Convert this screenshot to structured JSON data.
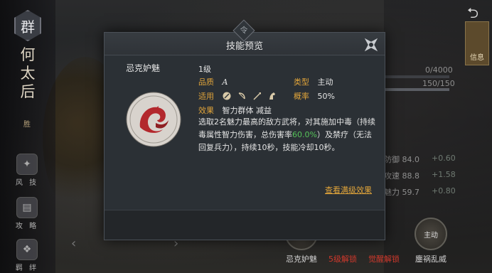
{
  "modal": {
    "title": "技能预览",
    "skill_name": "忌克妒魅",
    "level": "1级",
    "quality_label": "品质",
    "quality_value": "A",
    "type_label": "类型",
    "type_value": "主动",
    "suitable_label": "适用",
    "suitable_icons": [
      "shield-icon",
      "bow-icon",
      "spear-icon",
      "horse-icon"
    ],
    "rate_label": "概率",
    "rate_value": "50%",
    "effect_label": "效果",
    "effect_value": "智力群体 减益",
    "description_part1": "选取2名魅力最高的敌方武将，对其施加中毒（持续毒属性智力伤害，总伤害率",
    "description_highlight": "60.0%",
    "description_part2": "）及禁疗（无法回复兵力），持续10秒，技能冷却10秒。",
    "full_level_link": "查看满级效果",
    "crest_char": "令"
  },
  "hero": {
    "faction": "群",
    "name_chars": [
      "何",
      "太",
      "后"
    ],
    "sub_label": "胜"
  },
  "left_menu": [
    {
      "label": "风 技",
      "icon": "wind-icon"
    },
    {
      "label": "攻 略",
      "icon": "scroll-icon"
    },
    {
      "label": "羁 绊",
      "icon": "bond-icon"
    }
  ],
  "stats": {
    "bar1_text": "0/4000",
    "bar2_text": "150/150",
    "rows": [
      {
        "label": "防御",
        "value": "84.0",
        "plus": "+0.60"
      },
      {
        "label": "攻速",
        "value": "88.8",
        "plus": "+1.58"
      },
      {
        "label": "魅力",
        "value": "59.7",
        "plus": "+0.80"
      }
    ]
  },
  "info_tab": {
    "label": "信息"
  },
  "bottom_skills": [
    {
      "label": "忌克妒魅",
      "color": "#cfcfcf"
    },
    {
      "label": "5级解锁",
      "color": "#d0392c"
    },
    {
      "label": "觉醒解锁",
      "color": "#d0392c"
    },
    {
      "label": "鏖祸乱威",
      "color": "#cfcfcf",
      "badge": "主动"
    }
  ],
  "colors": {
    "accent_gold": "#e0a43a",
    "highlight_green": "#56c25a",
    "locked_red": "#d0392c"
  }
}
